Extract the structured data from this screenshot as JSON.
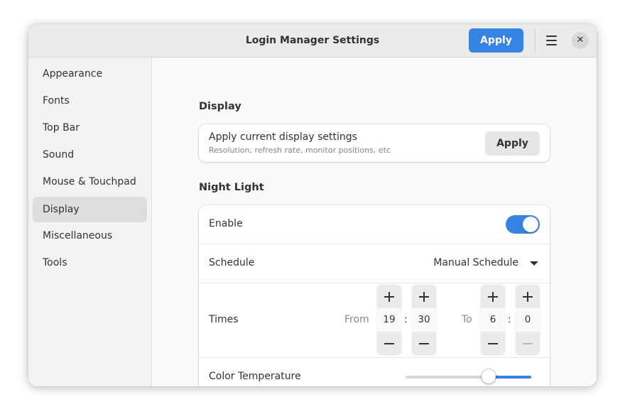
{
  "header": {
    "title": "Login Manager Settings",
    "apply_label": "Apply",
    "menu_icon": "hamburger-menu-icon",
    "close_icon": "close-icon",
    "close_glyph": "✕",
    "accent_color": "#3584e4"
  },
  "sidebar": {
    "items": [
      {
        "label": "Appearance"
      },
      {
        "label": "Fonts"
      },
      {
        "label": "Top Bar"
      },
      {
        "label": "Sound"
      },
      {
        "label": "Mouse & Touchpad"
      },
      {
        "label": "Display",
        "selected": true
      },
      {
        "label": "Miscellaneous"
      },
      {
        "label": "Tools"
      }
    ]
  },
  "display": {
    "section_title": "Display",
    "apply_row": {
      "title": "Apply current display settings",
      "subtitle": "Resolution, refresh rate, monitor positions, etc",
      "button_label": "Apply"
    }
  },
  "night_light": {
    "section_title": "Night Light",
    "enable": {
      "label": "Enable",
      "on": true
    },
    "schedule": {
      "label": "Schedule",
      "value": "Manual Schedule"
    },
    "times": {
      "label": "Times",
      "from_label": "From",
      "to_label": "To",
      "separator": ":",
      "from_hour": "19",
      "from_minute": "30",
      "to_hour": "6",
      "to_minute": "0"
    },
    "color_temperature": {
      "label": "Color Temperature",
      "level_fraction": 0.66
    }
  }
}
